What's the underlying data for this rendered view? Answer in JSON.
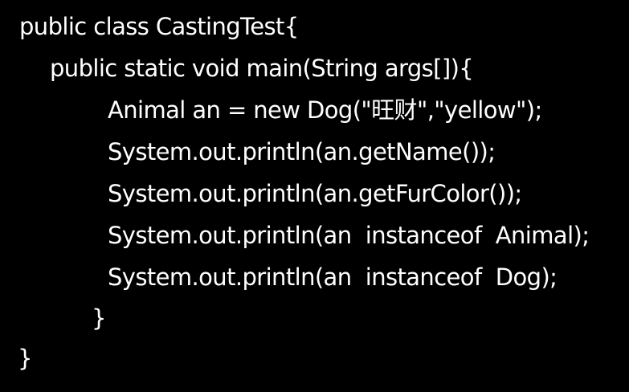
{
  "code": {
    "lines": [
      "public class CastingTest{",
      "public static void main(String args[]){",
      "Animal an = new Dog(\"旺财\",\"yellow\");",
      "System.out.println(an.getName());",
      "System.out.println(an.getFurColor());",
      "System.out.println(an  instanceof  Animal);",
      "System.out.println(an  instanceof  Dog);",
      "}",
      "}"
    ]
  }
}
